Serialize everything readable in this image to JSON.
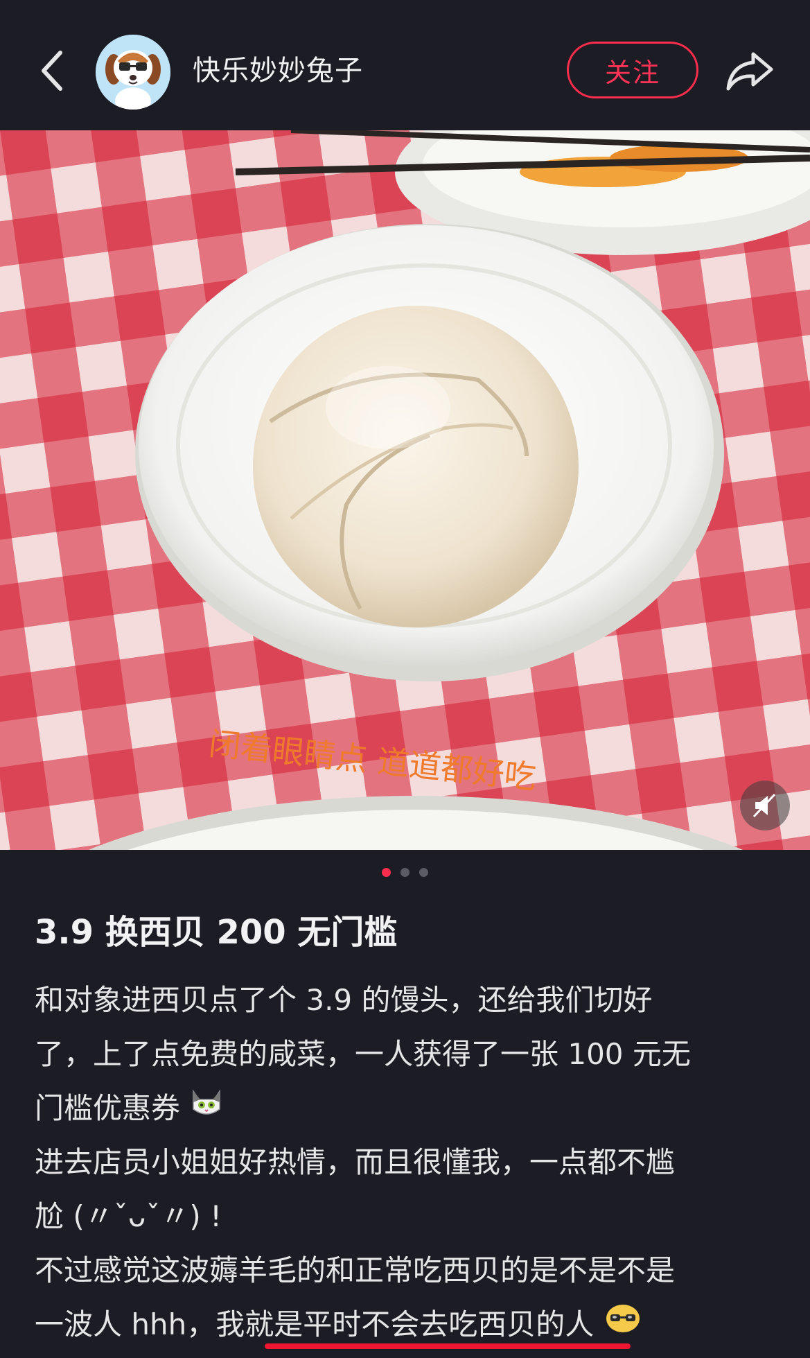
{
  "header": {
    "username": "快乐妙妙兔子",
    "follow_label": "关注",
    "icons": {
      "back": "chevron-left-icon",
      "share": "share-arrow-icon",
      "avatar": "beagle-dog-avatar"
    }
  },
  "photo": {
    "plate_text": "闭着眼睛点  道道都好吃",
    "carousel": {
      "current": 1,
      "total": 3
    },
    "mute_icon": "speaker-muted-icon"
  },
  "post": {
    "title": "3.9 换西贝 200 无门槛",
    "lines": [
      "和对象进西贝点了个 3.9 的馒头，还给我们切好",
      "了，上了点免费的咸菜，一人获得了一张 100 元无",
      "门槛优惠券",
      "进去店员小姐姐好热情，而且很懂我，一点都不尴",
      "尬 (〃ˇᴗˇ〃) !",
      "不过感觉这波薅羊毛的和正常吃西贝的是不是不是",
      "一波人 hhh，我就是平时不会去吃西贝的人"
    ],
    "inline_emojis": [
      "cat-emoji",
      "sunglasses-face-emoji"
    ]
  },
  "colors": {
    "background": "#1c1c24",
    "accent": "#ff2d4d",
    "text": "#e8e8ea"
  }
}
